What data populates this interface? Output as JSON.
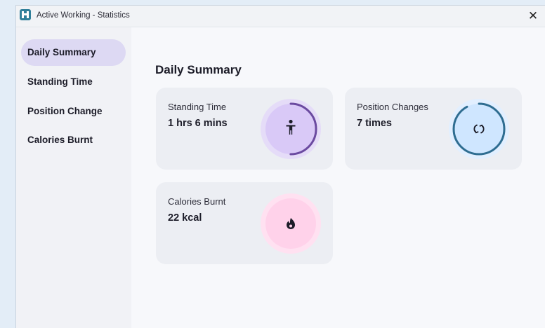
{
  "window": {
    "title": "Active Working - Statistics",
    "close_symbol": "✕"
  },
  "sidebar": {
    "items": [
      {
        "label": "Daily Summary",
        "active": true
      },
      {
        "label": "Standing Time",
        "active": false
      },
      {
        "label": "Position Change",
        "active": false
      },
      {
        "label": "Calories Burnt",
        "active": false
      }
    ]
  },
  "main": {
    "title": "Daily Summary",
    "cards": [
      {
        "label": "Standing Time",
        "value": "1 hrs 6 mins",
        "icon": "standing-person-icon",
        "accent": "#6b4aa0",
        "fill": "#d9c9f7",
        "progress": 0.5
      },
      {
        "label": "Position Changes",
        "value": "7 times",
        "icon": "refresh-icon",
        "accent": "#2f6d91",
        "fill": "#cfe6ff",
        "progress": 0.92
      },
      {
        "label": "Calories Burnt",
        "value": "22 kcal",
        "icon": "flame-icon",
        "accent": "#f0bcdc",
        "fill": "#ffd2ea",
        "progress": 0
      }
    ]
  }
}
